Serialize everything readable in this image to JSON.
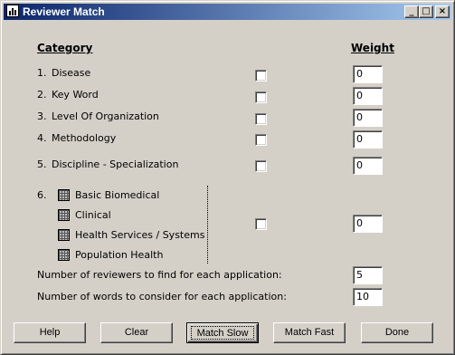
{
  "window": {
    "title": "Reviewer Match",
    "controls": {
      "minimize": "_",
      "maximize": "□",
      "close": "×"
    }
  },
  "headers": {
    "category": "Category",
    "weight": "Weight"
  },
  "categories": [
    {
      "num": "1.",
      "label": "Disease",
      "checked": false,
      "weight": "0"
    },
    {
      "num": "2.",
      "label": "Key Word",
      "checked": false,
      "weight": "0"
    },
    {
      "num": "3.",
      "label": "Level Of Organization",
      "checked": false,
      "weight": "0"
    },
    {
      "num": "4.",
      "label": "Methodology",
      "checked": false,
      "weight": "0"
    },
    {
      "num": "5.",
      "label": "Discipline - Specialization",
      "checked": false,
      "weight": "0"
    },
    {
      "num": "6.",
      "checked": false,
      "weight": "0",
      "options": [
        "Basic Biomedical",
        "Clinical",
        "Health Services / Systems",
        "Population Health"
      ]
    }
  ],
  "settings": {
    "reviewers_label": "Number of reviewers to find for each application:",
    "reviewers_value": "5",
    "words_label": "Number of words to consider for each application:",
    "words_value": "10"
  },
  "buttons": {
    "help": "Help",
    "clear": "Clear",
    "match_slow": "Match Slow",
    "match_fast": "Match Fast",
    "done": "Done"
  }
}
